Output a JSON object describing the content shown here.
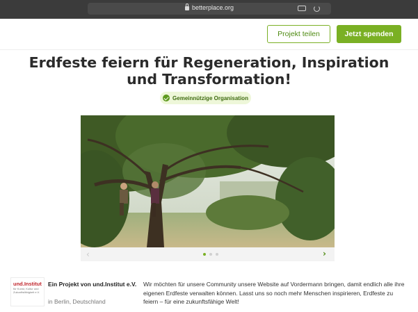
{
  "browser": {
    "url": "betterplace.org",
    "lock_icon": "lock-icon",
    "translate_icon": "translate-icon",
    "reload_icon": "reload-icon"
  },
  "header": {
    "share_label": "Projekt teilen",
    "donate_label": "Jetzt spenden"
  },
  "page": {
    "title": "Erdfeste feiern für Regeneration, Inspiration und Transformation!",
    "badge": "Gemeinnützige Organisation",
    "badge_icon": "check-circle-icon"
  },
  "gallery": {
    "prev_icon": "chevron-left-icon",
    "next_icon": "chevron-right-icon",
    "slide_count": 3,
    "active_slide": 1
  },
  "organization": {
    "logo_name": "und.Institut",
    "logo_subtitle": "für Kunst, Kultur und Zukunftsfähigkeit e.V.",
    "title": "Ein Projekt von und.Institut e.V.",
    "location": "in Berlin, Deutschland"
  },
  "description": "Wir möchten für unsere Community unsere Website auf Vordermann bringen, damit endlich alle ihre eigenen Erdfeste verwalten können. Lasst uns so noch mehr Menschen inspirieren, Erdfeste zu feiern – für eine zukunftsfähige Welt!",
  "colors": {
    "accent": "#7ab024",
    "accent_dark": "#4e8a12",
    "badge_bg": "#eef7d9",
    "browser_chrome": "#3b3b3b"
  }
}
